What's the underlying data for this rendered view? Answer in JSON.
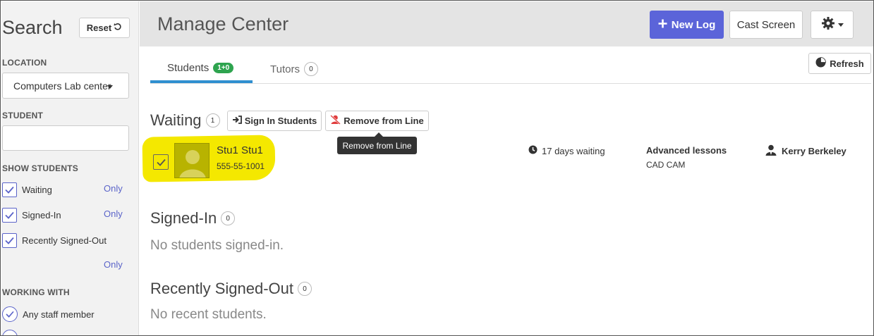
{
  "sidebar": {
    "title": "Search",
    "reset_label": "Reset",
    "location_label": "LOCATION",
    "location_value": "Computers Lab center",
    "student_label": "STUDENT",
    "student_value": "",
    "show_students_label": "SHOW STUDENTS",
    "filters": [
      {
        "label": "Waiting",
        "checked": true,
        "only": "Only"
      },
      {
        "label": "Signed-In",
        "checked": true,
        "only": "Only"
      },
      {
        "label": "Recently Signed-Out",
        "checked": true,
        "only": "Only"
      }
    ],
    "working_with_label": "WORKING WITH",
    "working_with_option": "Any staff member"
  },
  "header": {
    "title": "Manage Center",
    "new_log_label": "New Log",
    "cast_screen_label": "Cast Screen"
  },
  "tabs": [
    {
      "label": "Students",
      "badge": "1+0",
      "active": true
    },
    {
      "label": "Tutors",
      "badge": "0",
      "active": false
    }
  ],
  "refresh_label": "Refresh",
  "waiting": {
    "title": "Waiting",
    "count": "1",
    "sign_in_label": "Sign In Students",
    "remove_label": "Remove from Line",
    "tooltip": "Remove from Line",
    "student": {
      "name": "Stu1 Stu1",
      "id": "555-55-1001",
      "wait_time": "17 days waiting",
      "reason": "Advanced lessons",
      "reason_sub": "CAD CAM",
      "tutor": "Kerry Berkeley"
    }
  },
  "signed_in": {
    "title": "Signed-In",
    "count": "0",
    "empty": "No students signed-in."
  },
  "recent": {
    "title": "Recently Signed-Out",
    "count": "0",
    "empty": "No recent students."
  },
  "colors": {
    "primary": "#5b64d9",
    "badge_green": "#2ea44f",
    "tab_underline": "#2f8fd0",
    "highlight": "#f4e800"
  }
}
